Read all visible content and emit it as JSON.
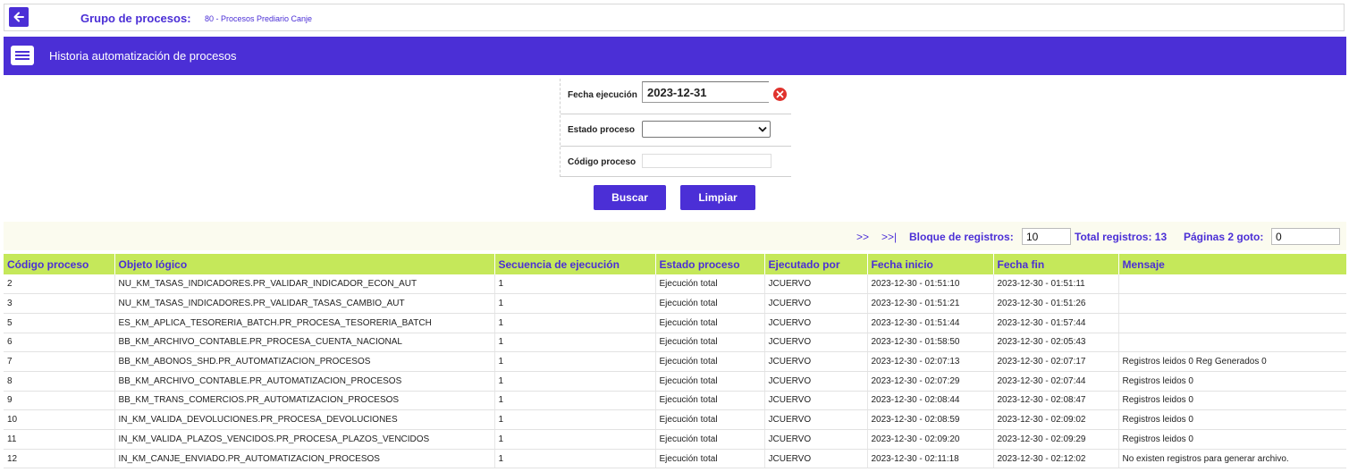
{
  "header": {
    "group_label": "Grupo de procesos:",
    "group_value": "80 - Procesos Prediario Canje"
  },
  "band": {
    "title": "Historia automatización de procesos"
  },
  "form": {
    "fecha_label": "Fecha ejecución",
    "fecha_value": "2023-12-31",
    "estado_label": "Estado proceso",
    "estado_value": "",
    "codigo_label": "Código proceso",
    "codigo_value": ""
  },
  "buttons": {
    "buscar": "Buscar",
    "limpiar": "Limpiar"
  },
  "pager": {
    "next": ">>",
    "last": ">>|",
    "bloque_label": "Bloque de registros:",
    "bloque_value": "10",
    "total_label": "Total registros: 13",
    "paginas_label": "Páginas 2 goto:",
    "goto_value": "0"
  },
  "table": {
    "columns": [
      "Código proceso",
      "Objeto lógico",
      "Secuencia de ejecución",
      "Estado proceso",
      "Ejecutado por",
      "Fecha inicio",
      "Fecha fin",
      "Mensaje"
    ],
    "rows": [
      [
        "2",
        "NU_KM_TASAS_INDICADORES.PR_VALIDAR_INDICADOR_ECON_AUT",
        "1",
        "Ejecución total",
        "JCUERVO",
        "2023-12-30 - 01:51:10",
        "2023-12-30 - 01:51:11",
        ""
      ],
      [
        "3",
        "NU_KM_TASAS_INDICADORES.PR_VALIDAR_TASAS_CAMBIO_AUT",
        "1",
        "Ejecución total",
        "JCUERVO",
        "2023-12-30 - 01:51:21",
        "2023-12-30 - 01:51:26",
        ""
      ],
      [
        "5",
        "ES_KM_APLICA_TESORERIA_BATCH.PR_PROCESA_TESORERIA_BATCH",
        "1",
        "Ejecución total",
        "JCUERVO",
        "2023-12-30 - 01:51:44",
        "2023-12-30 - 01:57:44",
        ""
      ],
      [
        "6",
        "BB_KM_ARCHIVO_CONTABLE.PR_PROCESA_CUENTA_NACIONAL",
        "1",
        "Ejecución total",
        "JCUERVO",
        "2023-12-30 - 01:58:50",
        "2023-12-30 - 02:05:43",
        ""
      ],
      [
        "7",
        "BB_KM_ABONOS_SHD.PR_AUTOMATIZACION_PROCESOS",
        "1",
        "Ejecución total",
        "JCUERVO",
        "2023-12-30 - 02:07:13",
        "2023-12-30 - 02:07:17",
        "Registros leidos 0 Reg Generados 0"
      ],
      [
        "8",
        "BB_KM_ARCHIVO_CONTABLE.PR_AUTOMATIZACION_PROCESOS",
        "1",
        "Ejecución total",
        "JCUERVO",
        "2023-12-30 - 02:07:29",
        "2023-12-30 - 02:07:44",
        "Registros leidos 0"
      ],
      [
        "9",
        "BB_KM_TRANS_COMERCIOS.PR_AUTOMATIZACION_PROCESOS",
        "1",
        "Ejecución total",
        "JCUERVO",
        "2023-12-30 - 02:08:44",
        "2023-12-30 - 02:08:47",
        "Registros leidos 0"
      ],
      [
        "10",
        "IN_KM_VALIDA_DEVOLUCIONES.PR_PROCESA_DEVOLUCIONES",
        "1",
        "Ejecución total",
        "JCUERVO",
        "2023-12-30 - 02:08:59",
        "2023-12-30 - 02:09:02",
        "Registros leidos 0"
      ],
      [
        "11",
        "IN_KM_VALIDA_PLAZOS_VENCIDOS.PR_PROCESA_PLAZOS_VENCIDOS",
        "1",
        "Ejecución total",
        "JCUERVO",
        "2023-12-30 - 02:09:20",
        "2023-12-30 - 02:09:29",
        "Registros leidos 0"
      ],
      [
        "12",
        "IN_KM_CANJE_ENVIADO.PR_AUTOMATIZACION_PROCESOS",
        "1",
        "Ejecución total",
        "JCUERVO",
        "2023-12-30 - 02:11:18",
        "2023-12-30 - 02:12:02",
        "No existen registros para generar archivo."
      ]
    ]
  },
  "icons": {
    "back": "arrow-left-icon",
    "band": "list-icon",
    "clear": "clear-x-icon",
    "select": "chevron-down-icon"
  },
  "colors": {
    "accent": "#4b2fd6",
    "table_header": "#c5e85a",
    "clear": "#e0322d"
  }
}
